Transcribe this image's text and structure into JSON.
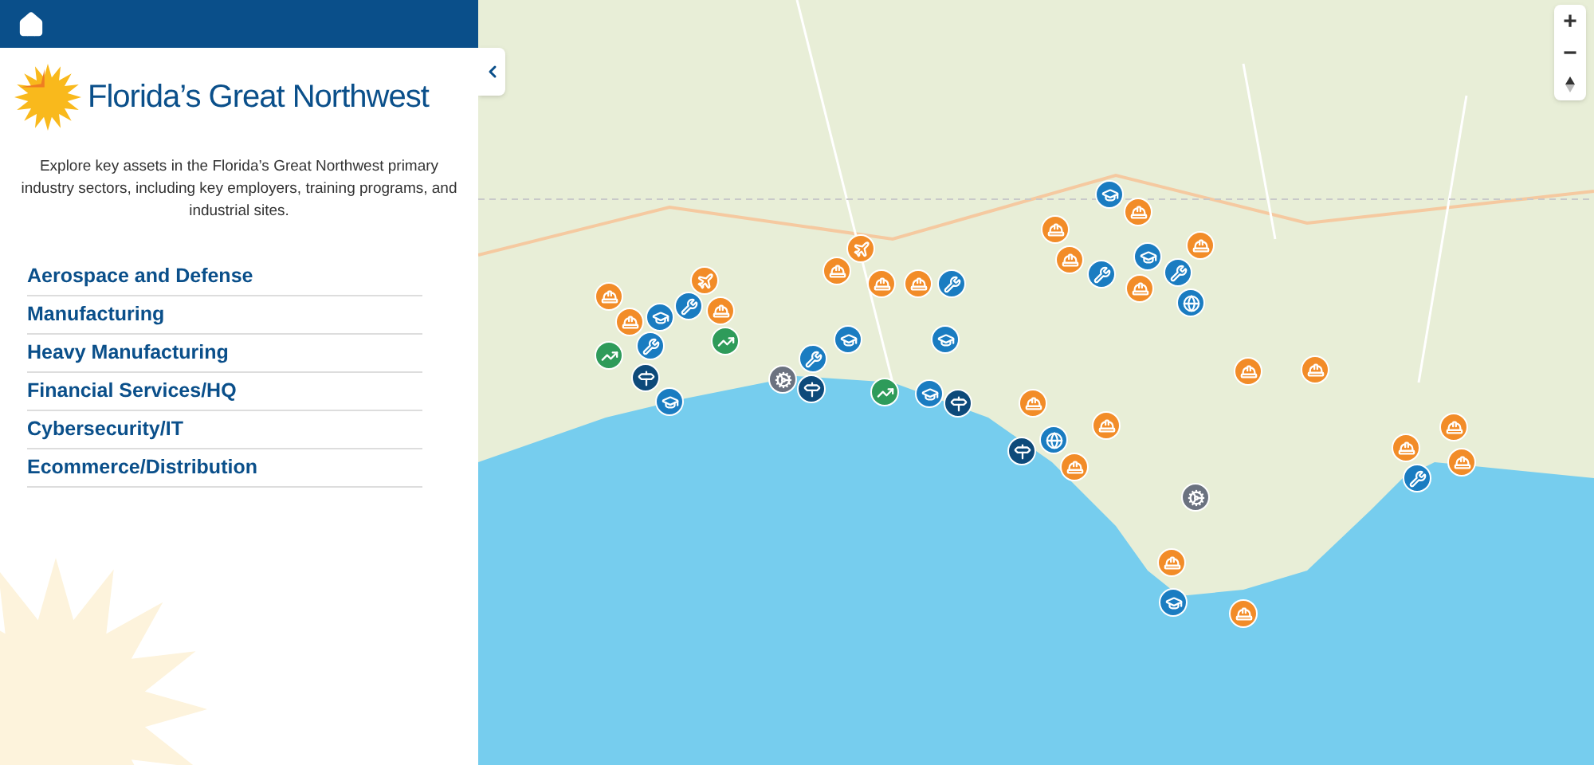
{
  "logo": {
    "text": "Florida’s Great Northwest"
  },
  "intro": "Explore key assets in the Florida’s Great Northwest primary industry sectors, including key employers, training programs, and industrial sites.",
  "sectors": [
    "Aerospace and Defense",
    "Manufacturing",
    "Heavy Manufacturing",
    "Financial Services/HQ",
    "Cybersecurity/IT",
    "Ecommerce/Distribution"
  ],
  "map": {
    "zoom_in": "+",
    "zoom_out": "−",
    "markers": [
      {
        "kind": "helmet",
        "color": "#f28c28"
      },
      {
        "kind": "helmet",
        "color": "#f28c28"
      },
      {
        "kind": "helmet",
        "color": "#f28c28"
      },
      {
        "kind": "helmet",
        "color": "#f28c28"
      },
      {
        "kind": "plane",
        "color": "#f28c28"
      },
      {
        "kind": "plane",
        "color": "#f28c28"
      },
      {
        "kind": "helmet",
        "color": "#f28c28"
      },
      {
        "kind": "helmet",
        "color": "#f28c28"
      },
      {
        "kind": "helmet",
        "color": "#f28c28"
      },
      {
        "kind": "helmet",
        "color": "#f28c28"
      },
      {
        "kind": "helmet",
        "color": "#f28c28"
      },
      {
        "kind": "helmet",
        "color": "#f28c28"
      },
      {
        "kind": "helmet",
        "color": "#f28c28"
      },
      {
        "kind": "helmet",
        "color": "#f28c28"
      },
      {
        "kind": "helmet",
        "color": "#f28c28"
      },
      {
        "kind": "helmet",
        "color": "#f28c28"
      },
      {
        "kind": "helmet",
        "color": "#f28c28"
      },
      {
        "kind": "helmet",
        "color": "#f28c28"
      },
      {
        "kind": "helmet",
        "color": "#f28c28"
      },
      {
        "kind": "helmet",
        "color": "#f28c28"
      },
      {
        "kind": "helmet",
        "color": "#f28c28"
      },
      {
        "kind": "helmet",
        "color": "#f28c28"
      },
      {
        "kind": "helmet",
        "color": "#f28c28"
      },
      {
        "kind": "tools",
        "color": "#1a7cc1"
      },
      {
        "kind": "tools",
        "color": "#1a7cc1"
      },
      {
        "kind": "tools",
        "color": "#1a7cc1"
      },
      {
        "kind": "tools",
        "color": "#1a7cc1"
      },
      {
        "kind": "tools",
        "color": "#1a7cc1"
      },
      {
        "kind": "tools",
        "color": "#1a7cc1"
      },
      {
        "kind": "tools",
        "color": "#1a7cc1"
      },
      {
        "kind": "school",
        "color": "#1a7cc1"
      },
      {
        "kind": "school",
        "color": "#1a7cc1"
      },
      {
        "kind": "school",
        "color": "#1a7cc1"
      },
      {
        "kind": "school",
        "color": "#1a7cc1"
      },
      {
        "kind": "school",
        "color": "#1a7cc1"
      },
      {
        "kind": "school",
        "color": "#1a7cc1"
      },
      {
        "kind": "school",
        "color": "#1a7cc1"
      },
      {
        "kind": "school",
        "color": "#1a7cc1"
      },
      {
        "kind": "globe",
        "color": "#1a7cc1"
      },
      {
        "kind": "globe",
        "color": "#1a7cc1"
      },
      {
        "kind": "sign",
        "color": "#0d4a7a"
      },
      {
        "kind": "sign",
        "color": "#0d4a7a"
      },
      {
        "kind": "sign",
        "color": "#0d4a7a"
      },
      {
        "kind": "sign",
        "color": "#0d4a7a"
      },
      {
        "kind": "chart",
        "color": "#2e9b5a"
      },
      {
        "kind": "chart",
        "color": "#2e9b5a"
      },
      {
        "kind": "chart",
        "color": "#2e9b5a"
      },
      {
        "kind": "gear",
        "color": "#6b7280"
      },
      {
        "kind": "gear",
        "color": "#6b7280"
      }
    ]
  }
}
